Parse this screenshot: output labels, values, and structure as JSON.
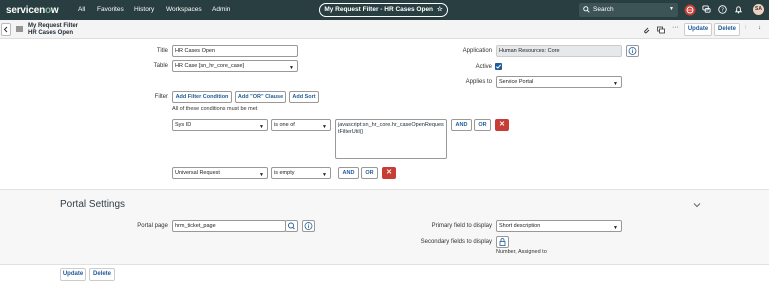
{
  "nav": {
    "logo_prefix": "servicen",
    "logo_o": "o",
    "logo_suffix": "w",
    "menu": [
      "All",
      "Favorites",
      "History",
      "Workspaces",
      "Admin"
    ],
    "context_title": "My Request Filter - HR Cases Open",
    "search_placeholder": "Search",
    "avatar_initials": "SA"
  },
  "header": {
    "form_title_line1": "My Request Filter",
    "form_title_line2": "HR Cases Open",
    "update_label": "Update",
    "delete_label": "Delete"
  },
  "form": {
    "title_label": "Title",
    "title_value": "HR Cases Open",
    "table_label": "Table",
    "table_value": "HR Case [sn_hr_core_case]",
    "application_label": "Application",
    "application_value": "Human Resources: Core",
    "active_label": "Active",
    "active": true,
    "applies_to_label": "Applies to",
    "applies_to_value": "Service Portal",
    "filter_label": "Filter"
  },
  "filter": {
    "add_condition": "Add Filter Condition",
    "add_or": "Add \"OR\" Clause",
    "add_sort": "Add Sort",
    "all_conditions_text": "All of these conditions must be met",
    "row1": {
      "field": "Sys ID",
      "operator": "is one of",
      "value": "javascript:sn_hr_core.hr_caseOpenRequestFilterUtil()"
    },
    "row2": {
      "field": "Universal Request",
      "operator": "is empty"
    },
    "and_label": "AND",
    "or_label": "OR",
    "remove_symbol": "✕"
  },
  "portal": {
    "section_title": "Portal Settings",
    "portal_page_label": "Portal page",
    "portal_page_value": "hrm_ticket_page",
    "primary_field_label": "Primary field to display",
    "primary_field_value": "Short description",
    "secondary_fields_label": "Secondary fields to display",
    "secondary_fields_value": "Number, Assigned to"
  },
  "footer": {
    "update_label": "Update",
    "delete_label": "Delete"
  },
  "colors": {
    "nav_bg": "#293e40",
    "accent": "#1f5c99",
    "delete_red": "#c83c36"
  }
}
